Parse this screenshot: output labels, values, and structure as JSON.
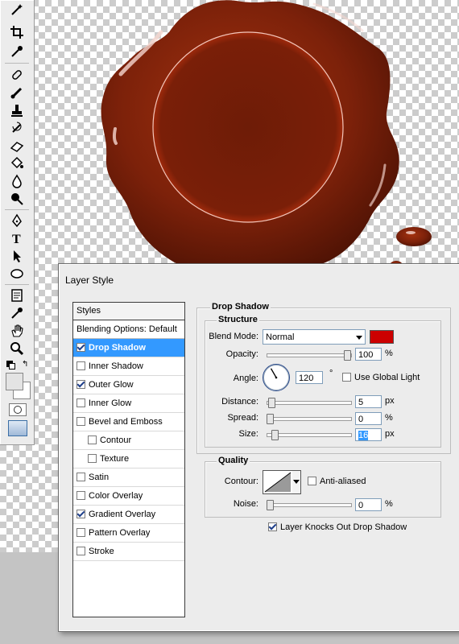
{
  "dialog": {
    "title": "Layer Style",
    "styles_header": "Styles",
    "style_items": [
      {
        "label": "Blending Options: Default",
        "checkbox": false,
        "checked": false,
        "selected": false,
        "indent": false
      },
      {
        "label": "Drop Shadow",
        "checkbox": true,
        "checked": true,
        "selected": true,
        "indent": false
      },
      {
        "label": "Inner Shadow",
        "checkbox": true,
        "checked": false,
        "selected": false,
        "indent": false
      },
      {
        "label": "Outer Glow",
        "checkbox": true,
        "checked": true,
        "selected": false,
        "indent": false
      },
      {
        "label": "Inner Glow",
        "checkbox": true,
        "checked": false,
        "selected": false,
        "indent": false
      },
      {
        "label": "Bevel and Emboss",
        "checkbox": true,
        "checked": false,
        "selected": false,
        "indent": false
      },
      {
        "label": "Contour",
        "checkbox": true,
        "checked": false,
        "selected": false,
        "indent": true
      },
      {
        "label": "Texture",
        "checkbox": true,
        "checked": false,
        "selected": false,
        "indent": true
      },
      {
        "label": "Satin",
        "checkbox": true,
        "checked": false,
        "selected": false,
        "indent": false
      },
      {
        "label": "Color Overlay",
        "checkbox": true,
        "checked": false,
        "selected": false,
        "indent": false
      },
      {
        "label": "Gradient Overlay",
        "checkbox": true,
        "checked": true,
        "selected": false,
        "indent": false
      },
      {
        "label": "Pattern Overlay",
        "checkbox": true,
        "checked": false,
        "selected": false,
        "indent": false
      },
      {
        "label": "Stroke",
        "checkbox": true,
        "checked": false,
        "selected": false,
        "indent": false
      }
    ],
    "drop_shadow": {
      "section_title": "Drop Shadow",
      "structure_title": "Structure",
      "blend_mode_label": "Blend Mode:",
      "blend_mode_value": "Normal",
      "shadow_color": "#cc0000",
      "opacity_label": "Opacity:",
      "opacity_value": "100",
      "opacity_unit": "%",
      "opacity_fraction": 1.0,
      "angle_label": "Angle:",
      "angle_value": "120",
      "angle_unit": "°",
      "use_global_light_label": "Use Global Light",
      "use_global_light_checked": false,
      "distance_label": "Distance:",
      "distance_value": "5",
      "distance_unit": "px",
      "distance_fraction": 0.02,
      "spread_label": "Spread:",
      "spread_value": "0",
      "spread_unit": "%",
      "spread_fraction": 0.0,
      "size_label": "Size:",
      "size_value": "16",
      "size_unit": "px",
      "size_fraction": 0.06,
      "quality_title": "Quality",
      "contour_label": "Contour:",
      "anti_aliased_label": "Anti-aliased",
      "anti_aliased_checked": false,
      "noise_label": "Noise:",
      "noise_value": "0",
      "noise_unit": "%",
      "noise_fraction": 0.0,
      "knockout_label": "Layer Knocks Out Drop Shadow",
      "knockout_checked": true
    }
  },
  "toolbox": {
    "tools": [
      "magic-wand-icon",
      "crop-icon",
      "eyedropper-icon",
      "healing-brush-icon",
      "brush-icon",
      "clone-stamp-icon",
      "history-brush-icon",
      "eraser-icon",
      "paint-bucket-icon",
      "blur-icon",
      "dodge-icon",
      "pen-icon",
      "type-icon",
      "path-selection-icon",
      "ellipse-icon",
      "notes-icon",
      "color-sampler-icon",
      "hand-icon",
      "zoom-icon"
    ]
  },
  "colors": {
    "wax": "#7a1c08",
    "selection_blue": "#3399ff",
    "dialog_bg": "#ececec"
  }
}
